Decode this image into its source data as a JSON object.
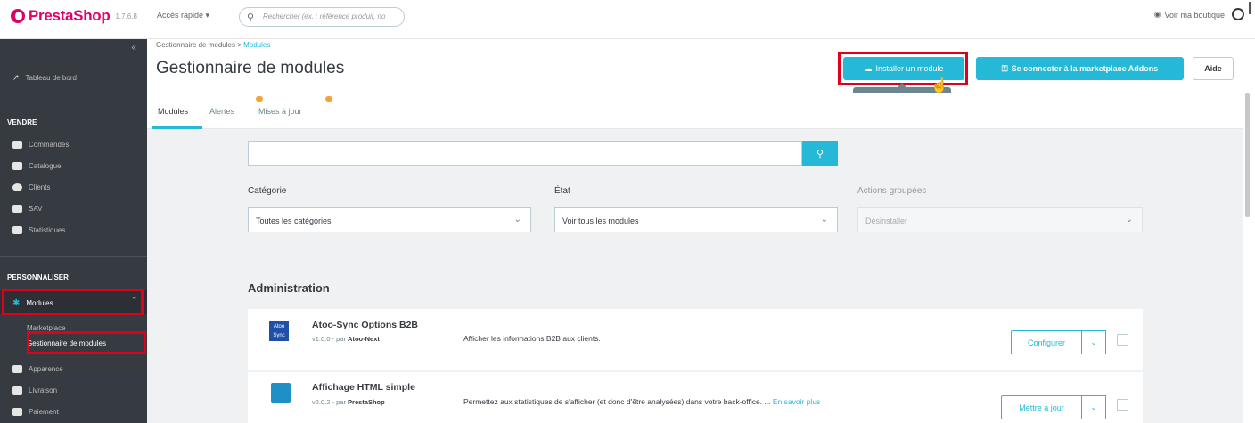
{
  "topbar": {
    "logo_text": "PrestaShop",
    "version": "1.7.6.8",
    "quick_access": "Accès rapide ▾",
    "search_placeholder": "Rechercher (ex. : référence produit, no",
    "view_shop": "Voir ma boutique"
  },
  "sidebar": {
    "collapse_icon": "«",
    "dashboard": "Tableau de bord",
    "section_sell": "VENDRE",
    "sell_items": [
      "Commandes",
      "Catalogue",
      "Clients",
      "SAV",
      "Statistiques"
    ],
    "section_customize": "PERSONNALISER",
    "modules": "Modules",
    "modules_sub": [
      "Marketplace",
      "Gestionnaire de modules"
    ],
    "after_items": [
      "Apparence",
      "Livraison",
      "Paiement"
    ]
  },
  "header": {
    "breadcrumb_parent": "Gestionnaire de modules",
    "breadcrumb_sep": ">",
    "breadcrumb_current": "Modules",
    "title": "Gestionnaire de modules",
    "install_label": "Installer un module",
    "connect_label": "Se connecter à la marketplace Addons",
    "help_label": "Aide",
    "tooltip": "Installer un module"
  },
  "tabs": [
    "Modules",
    "Alertes",
    "Mises à jour"
  ],
  "filters": {
    "category_label": "Catégorie",
    "category_value": "Toutes les catégories",
    "state_label": "État",
    "state_value": "Voir tous les modules",
    "bulk_label": "Actions groupées",
    "bulk_value": "Désinstaller"
  },
  "section_title": "Administration",
  "modules": [
    {
      "name": "Atoo-Sync Options B2B",
      "version": "v1.0.0 - par",
      "author": "Atoo-Next",
      "description": "Afficher les informations B2B aux clients.",
      "more": "",
      "action": "Configurer",
      "logo_text": "Atoo Sync",
      "logo_color": "#1f4fa8"
    },
    {
      "name": "Affichage HTML simple",
      "version": "v2.0.2 - par",
      "author": "PrestaShop",
      "description": "Permettez aux statistiques de s'afficher (et donc d'être analysées) dans votre back-office. ...",
      "more": "En savoir plus",
      "action": "Mettre à jour",
      "logo_text": "",
      "logo_color": "#1e8fc7"
    }
  ],
  "colors": {
    "accent": "#25b9d7",
    "sidebar": "#363a41",
    "brand": "#df0067",
    "highlight": "#e0001b"
  }
}
